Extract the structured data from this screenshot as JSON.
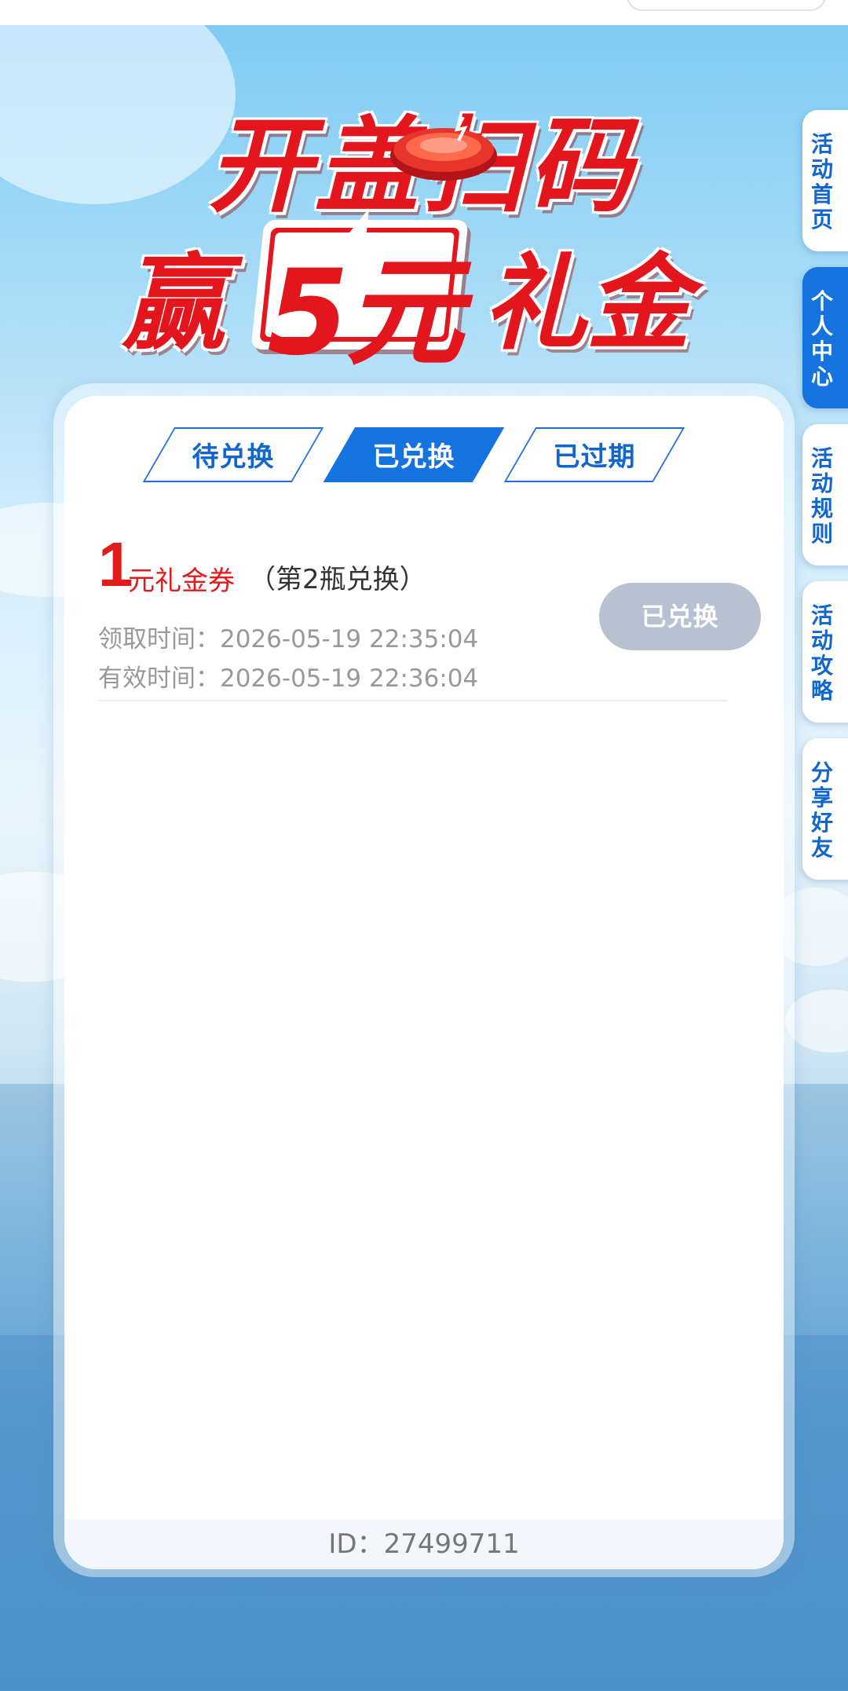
{
  "hero": {
    "line1": "开盖扫码",
    "win": "赢",
    "amount": "5元",
    "gift": "礼金"
  },
  "tabs": [
    {
      "label": "待兑换",
      "active": false
    },
    {
      "label": "已兑换",
      "active": true
    },
    {
      "label": "已过期",
      "active": false
    }
  ],
  "coupon": {
    "amount": "1",
    "unit": "元礼金券",
    "note": "（第2瓶兑换）",
    "claim_time": "领取时间：2026-05-19 22:35:04",
    "valid_time": "有效时间：2026-05-19 22:36:04",
    "status": "已兑换"
  },
  "footer": {
    "id_text": "ID：27499711"
  },
  "side_nav": [
    {
      "label": "活动首页",
      "active": false
    },
    {
      "label": "个人中心",
      "active": true
    },
    {
      "label": "活动规则",
      "active": false
    },
    {
      "label": "活动攻略",
      "active": false
    },
    {
      "label": "分享好友",
      "active": false
    }
  ],
  "colors": {
    "accent_blue": "#1573e0",
    "red": "#e3161d",
    "disabled": "#b8c1d0"
  }
}
